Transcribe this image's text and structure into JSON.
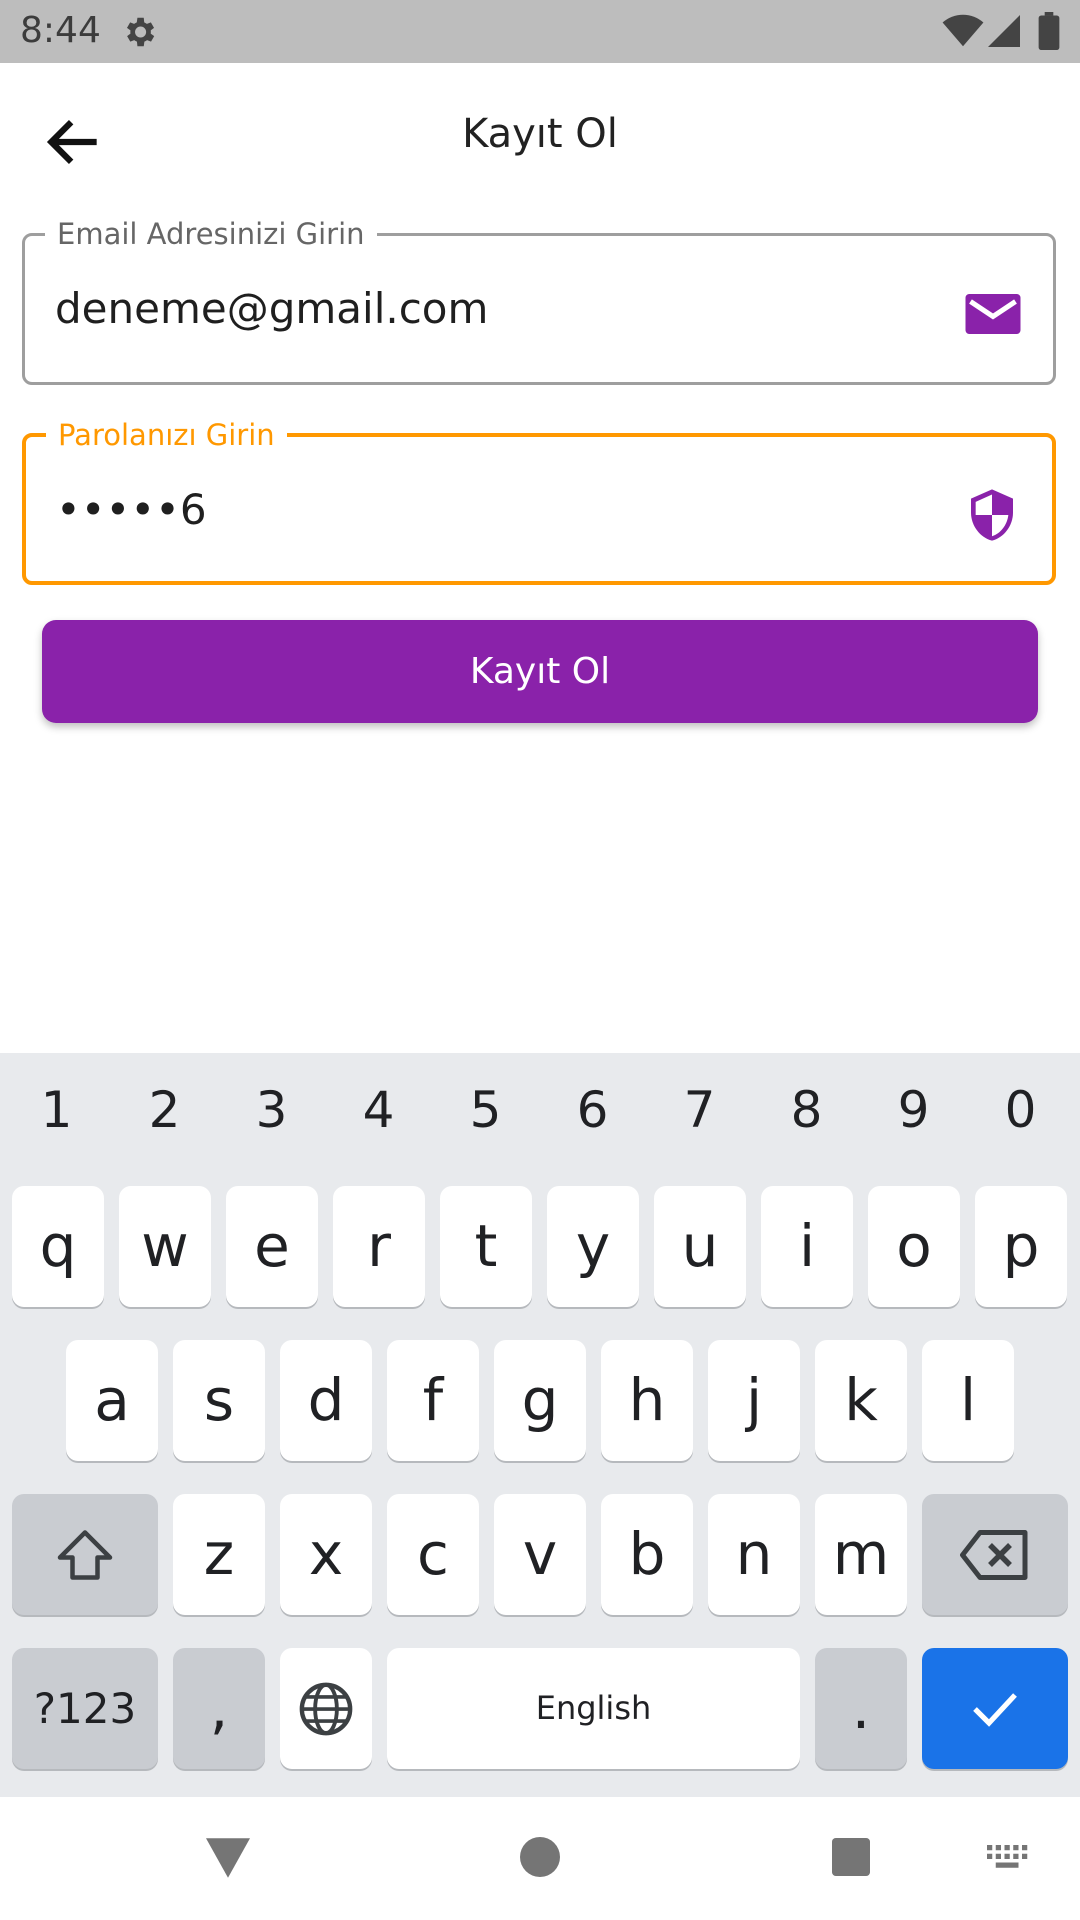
{
  "status": {
    "time": "8:44"
  },
  "app_bar": {
    "title": "Kayıt Ol"
  },
  "form": {
    "email": {
      "label": "Email Adresinizi Girin",
      "value": "deneme@gmail.com"
    },
    "password": {
      "label": "Parolanızı Girin",
      "value": "•••••6"
    },
    "submit_label": "Kayıt Ol"
  },
  "keyboard": {
    "numbers": [
      "1",
      "2",
      "3",
      "4",
      "5",
      "6",
      "7",
      "8",
      "9",
      "0"
    ],
    "row1": [
      "q",
      "w",
      "e",
      "r",
      "t",
      "y",
      "u",
      "i",
      "o",
      "p"
    ],
    "row2": [
      "a",
      "s",
      "d",
      "f",
      "g",
      "h",
      "j",
      "k",
      "l"
    ],
    "row3": [
      "z",
      "x",
      "c",
      "v",
      "b",
      "n",
      "m"
    ],
    "symbols_label": "?123",
    "comma": ",",
    "space_label": "English",
    "period": "."
  },
  "colors": {
    "accent_purple": "#8a22aa",
    "focus_orange": "#ff9800",
    "keyboard_blue": "#1a73e8"
  },
  "icons": {
    "status": [
      "gear-icon",
      "wifi-icon",
      "signal-icon",
      "battery-icon"
    ],
    "email_field": "envelope-icon",
    "password_field": "shield-icon",
    "keyboard": [
      "shift-icon",
      "backspace-icon",
      "globe-icon",
      "checkmark-icon"
    ],
    "navigation": [
      "back-triangle-icon",
      "home-circle-icon",
      "recents-square-icon",
      "keyboard-switch-icon"
    ]
  }
}
